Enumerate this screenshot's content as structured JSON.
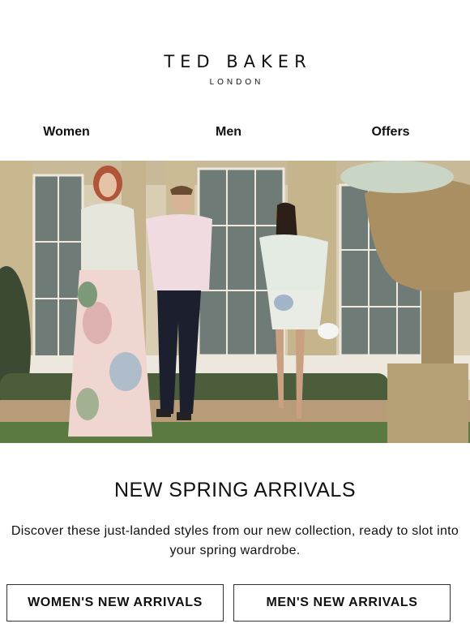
{
  "header": {
    "brand": "TED BAKER",
    "sub_brand": "LONDON"
  },
  "nav": {
    "women": "Women",
    "men": "Men",
    "offers": "Offers"
  },
  "hero": {
    "subject": "three models in floral spring outfits in front of an orangery"
  },
  "content": {
    "headline": "NEW SPRING ARRIVALS",
    "body": "Discover these just-landed styles from our new collection, ready to slot into your spring wardrobe."
  },
  "buttons": {
    "womens": "WOMEN'S NEW ARRIVALS",
    "mens": "MEN'S NEW ARRIVALS"
  }
}
